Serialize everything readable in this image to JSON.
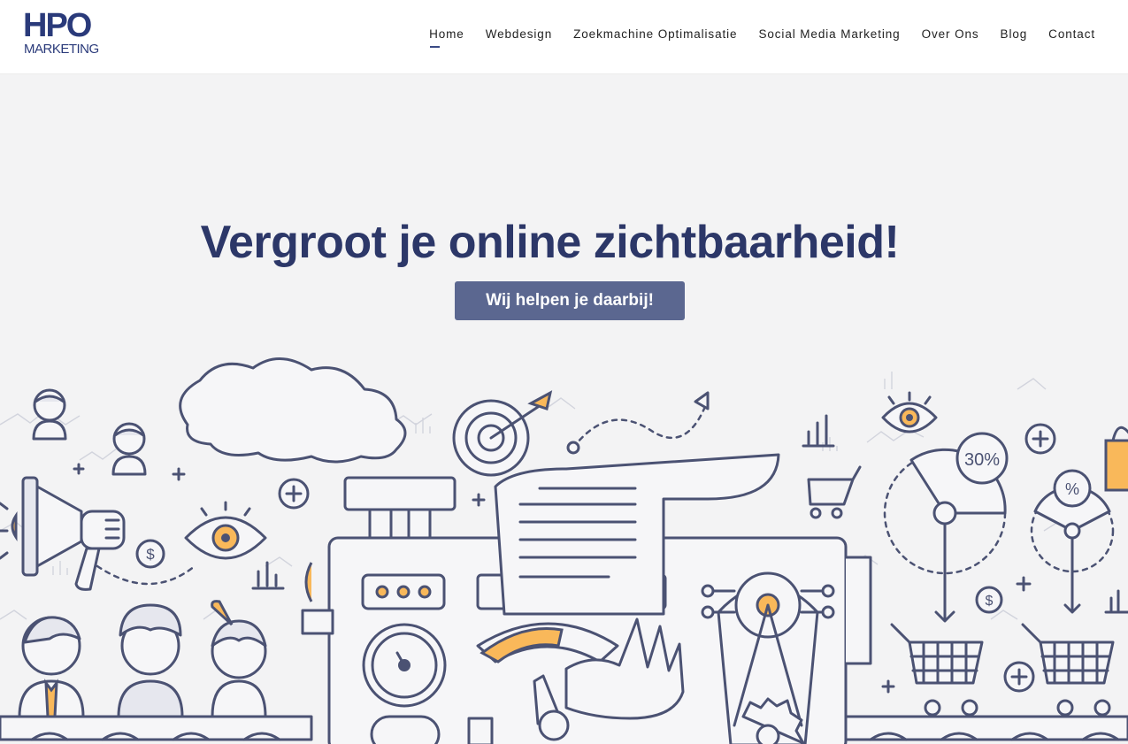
{
  "header": {
    "logo": {
      "line1": "HPO",
      "line2": "MARKETING"
    },
    "nav": [
      {
        "label": "Home",
        "active": true
      },
      {
        "label": "Webdesign"
      },
      {
        "label": "Zoekmachine Optimalisatie"
      },
      {
        "label": "Social Media Marketing"
      },
      {
        "label": "Over Ons"
      },
      {
        "label": "Blog"
      },
      {
        "label": "Contact"
      }
    ]
  },
  "hero": {
    "title": "Vergroot je online zichtbaarheid!",
    "cta_label": "Wij helpen je daarbij!"
  },
  "illustration": {
    "badges": [
      "30%",
      "%",
      "$"
    ]
  },
  "colors": {
    "brand_navy": "#2c3768",
    "button": "#5b6790",
    "accent_orange": "#f9b85a",
    "hero_bg": "#f3f3f4"
  }
}
